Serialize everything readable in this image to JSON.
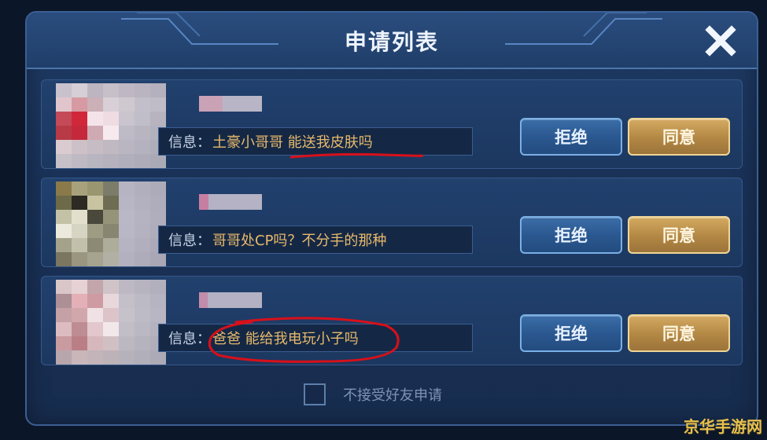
{
  "dialog": {
    "title": "申请列表"
  },
  "requests": [
    {
      "label": "信息：",
      "message": "土豪小哥哥 能送我皮肤吗",
      "reject": "拒绝",
      "accept": "同意"
    },
    {
      "label": "信息：",
      "message": "哥哥处CP吗？不分手的那种",
      "reject": "拒绝",
      "accept": "同意"
    },
    {
      "label": "信息：",
      "message": "爸爸 能给我电玩小子吗",
      "reject": "拒绝",
      "accept": "同意"
    }
  ],
  "footer": {
    "checkbox_label": "不接受好友申请"
  },
  "watermark": "京华手游网",
  "colors": {
    "message_text": "#e8b96a",
    "annotation": "#d8101a",
    "accept_button": "#b58a46",
    "reject_button": "#2b5890"
  },
  "icons": [
    "close-icon"
  ]
}
